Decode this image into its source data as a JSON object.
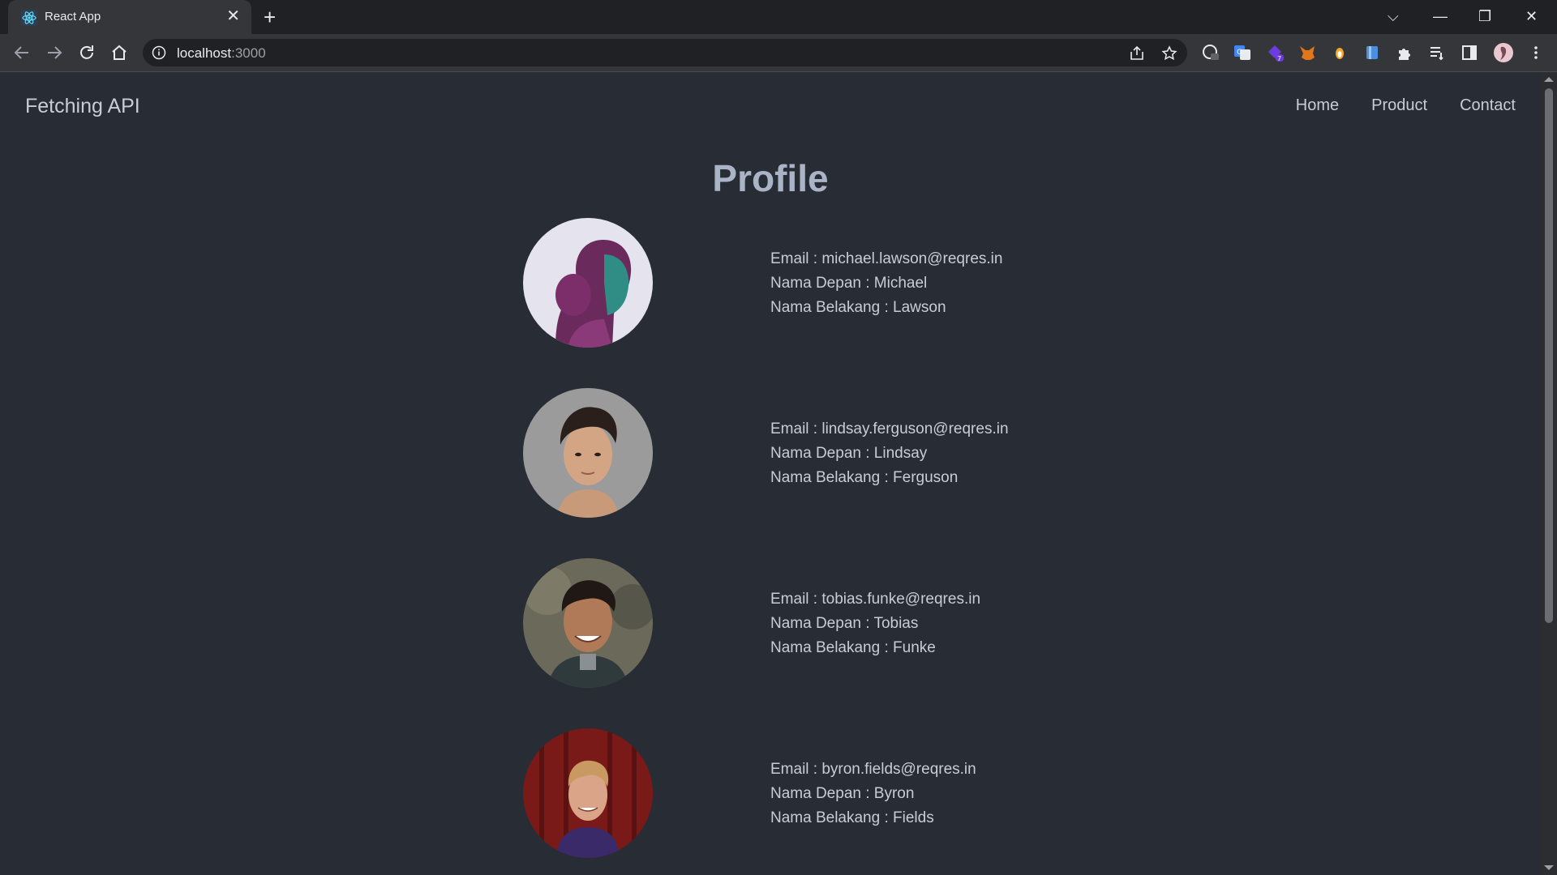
{
  "browser": {
    "tab_title": "React App",
    "tab_close_glyph": "✕",
    "new_tab_glyph": "+",
    "url_host": "localhost",
    "url_port": ":3000",
    "icons": [
      "react-favicon",
      "back-arrow-icon",
      "forward-arrow-icon",
      "reload-icon",
      "home-icon",
      "site-info-icon",
      "share-icon",
      "star-icon",
      "extension-icons",
      "puzzle-icon",
      "reading-list-icon",
      "side-panel-icon",
      "profile-avatar",
      "kebab-menu-icon"
    ],
    "extension_badge": "7",
    "window_controls": {
      "tab_search": "⌵",
      "minimize": "—",
      "restore": "❐",
      "close": "✕"
    }
  },
  "page": {
    "brand": "Fetching API",
    "nav": [
      {
        "label": "Home"
      },
      {
        "label": "Product"
      },
      {
        "label": "Contact"
      }
    ],
    "title": "Profile",
    "profiles": [
      {
        "email": "Email : michael.lawson@reqres.in",
        "first": "Nama Depan : Michael",
        "last": "Nama Belakang : Lawson"
      },
      {
        "email": "Email : lindsay.ferguson@reqres.in",
        "first": "Nama Depan : Lindsay",
        "last": "Nama Belakang : Ferguson"
      },
      {
        "email": "Email : tobias.funke@reqres.in",
        "first": "Nama Depan : Tobias",
        "last": "Nama Belakang : Funke"
      },
      {
        "email": "Email : byron.fields@reqres.in",
        "first": "Nama Depan : Byron",
        "last": "Nama Belakang : Fields"
      }
    ]
  },
  "colors": {
    "page_bg": "#282c34",
    "text": "#c7ccd6",
    "title": "#abb4c7",
    "chrome_dark": "#202124",
    "chrome_toolbar": "#35363a"
  }
}
